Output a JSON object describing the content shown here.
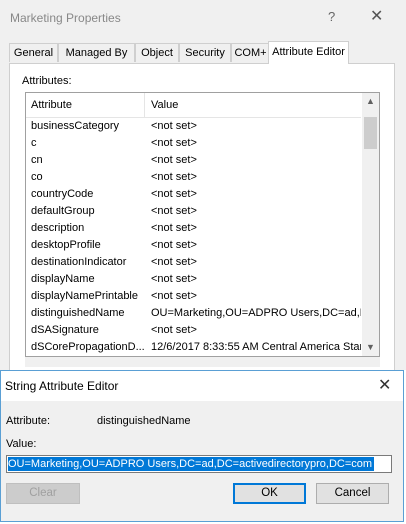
{
  "properties_window": {
    "title": "Marketing Properties",
    "help_glyph": "?",
    "close_glyph": "✕",
    "tabs": [
      "General",
      "Managed By",
      "Object",
      "Security",
      "COM+",
      "Attribute Editor"
    ],
    "active_tab": "Attribute Editor",
    "attributes_label": "Attributes:",
    "columns": {
      "attribute": "Attribute",
      "value": "Value"
    },
    "rows": [
      {
        "attribute": "businessCategory",
        "value": "<not set>"
      },
      {
        "attribute": "c",
        "value": "<not set>"
      },
      {
        "attribute": "cn",
        "value": "<not set>"
      },
      {
        "attribute": "co",
        "value": "<not set>"
      },
      {
        "attribute": "countryCode",
        "value": "<not set>"
      },
      {
        "attribute": "defaultGroup",
        "value": "<not set>"
      },
      {
        "attribute": "description",
        "value": "<not set>"
      },
      {
        "attribute": "desktopProfile",
        "value": "<not set>"
      },
      {
        "attribute": "destinationIndicator",
        "value": "<not set>"
      },
      {
        "attribute": "displayName",
        "value": "<not set>"
      },
      {
        "attribute": "displayNamePrintable",
        "value": "<not set>"
      },
      {
        "attribute": "distinguishedName",
        "value": "OU=Marketing,OU=ADPRO Users,DC=ad,D("
      },
      {
        "attribute": "dSASignature",
        "value": "<not set>"
      },
      {
        "attribute": "dSCorePropagationD...",
        "value": "12/6/2017 8:33:55 AM Central America Star"
      }
    ],
    "scroll_up_glyph": "▲",
    "scroll_down_glyph": "▼"
  },
  "string_editor": {
    "title": "String Attribute Editor",
    "close_glyph": "✕",
    "attribute_label": "Attribute:",
    "attribute_value": "distinguishedName",
    "value_label": "Value:",
    "value": "OU=Marketing,OU=ADPRO Users,DC=ad,DC=activedirectorypro,DC=com",
    "buttons": {
      "clear": "Clear",
      "ok": "OK",
      "cancel": "Cancel"
    }
  }
}
